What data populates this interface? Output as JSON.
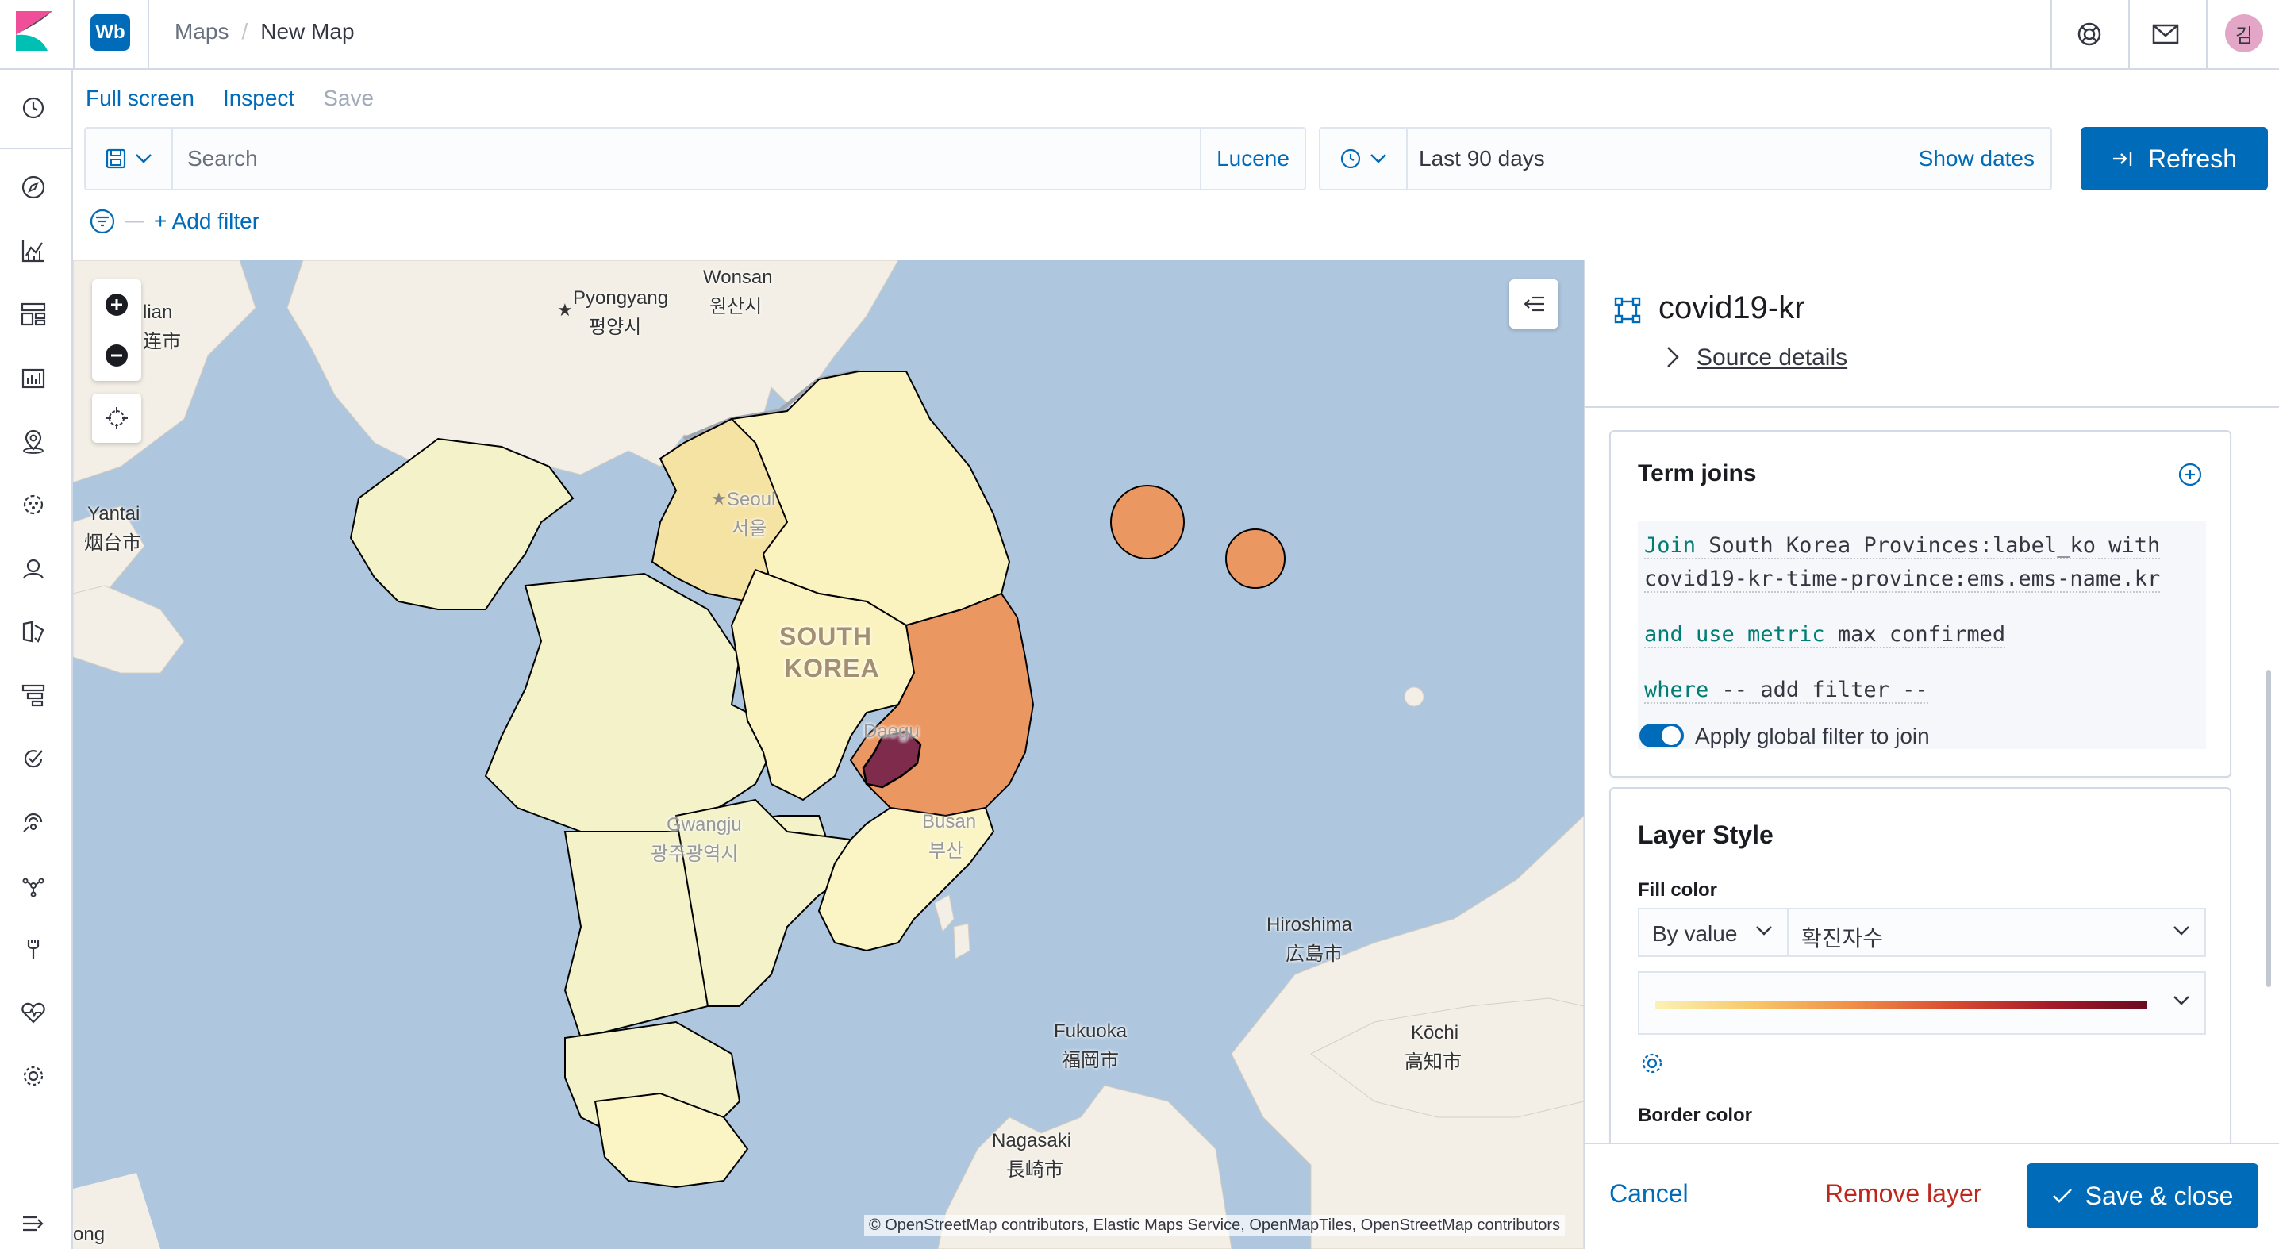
{
  "header": {
    "space_initials": "Wb",
    "breadcrumbs": [
      "Maps",
      "New Map"
    ],
    "avatar_initial": "김"
  },
  "top_menu": {
    "full_screen": "Full screen",
    "inspect": "Inspect",
    "save": "Save"
  },
  "query_bar": {
    "search_placeholder": "Search",
    "language": "Lucene",
    "time_range": "Last 90 days",
    "show_dates": "Show dates",
    "refresh": "Refresh"
  },
  "filters": {
    "add_filter": "+ Add filter"
  },
  "map": {
    "attribution": "© OpenStreetMap contributors, Elastic Maps Service, OpenMapTiles, OpenStreetMap contributors",
    "labels": {
      "wonsan": "Wonsan",
      "wonsan_ko": "원산시",
      "pyongyang": "Pyongyang",
      "pyongyang_ko": "평양시",
      "dandong_partial": "lian",
      "dandong_partial_ko": "连市",
      "yantai": "Yantai",
      "yantai_ko": "烟台市",
      "seoul": "Seoul",
      "seoul_ko": "서울",
      "south_korea_1": "SOUTH",
      "south_korea_2": "KOREA",
      "daegu": "Daegu",
      "busan": "Busan",
      "busan_ko": "부산",
      "gwangju": "Gwangju",
      "gwangju_ko": "광주광역시",
      "hiroshima": "Hiroshima",
      "hiroshima_ko": "広島市",
      "fukuoka": "Fukuoka",
      "fukuoka_ko": "福岡市",
      "kochi": "Kōchi",
      "kochi_ko": "高知市",
      "nagasaki": "Nagasaki",
      "nagasaki_ko": "長崎市",
      "bottom_partial": "ong"
    },
    "choropleth_colors": {
      "lowest": "#f3f2c9",
      "low": "#fbf3bf",
      "mid": "#f5e3a4",
      "high": "#eb9762",
      "highest": "#7f2b4c"
    }
  },
  "panel": {
    "layer_name": "covid19-kr",
    "source_details": "Source details",
    "term_joins": {
      "title": "Term joins",
      "join_keyword": "Join",
      "join_left": "South Korea Provinces:label_ko",
      "with_keyword": "with",
      "join_right": "covid19-kr-time-province:ems.ems-name.kr",
      "and_use_metric": "and use metric",
      "metric": "max confirmed",
      "where_keyword": "where",
      "where_value": "-- add filter --",
      "apply_global_filter": "Apply global filter to join"
    },
    "layer_style": {
      "title": "Layer Style",
      "fill_color_label": "Fill color",
      "fill_mode": "By value",
      "fill_field": "확진자수",
      "border_color_label": "Border color"
    },
    "footer": {
      "cancel": "Cancel",
      "remove_layer": "Remove layer",
      "save_close": "Save & close"
    }
  }
}
